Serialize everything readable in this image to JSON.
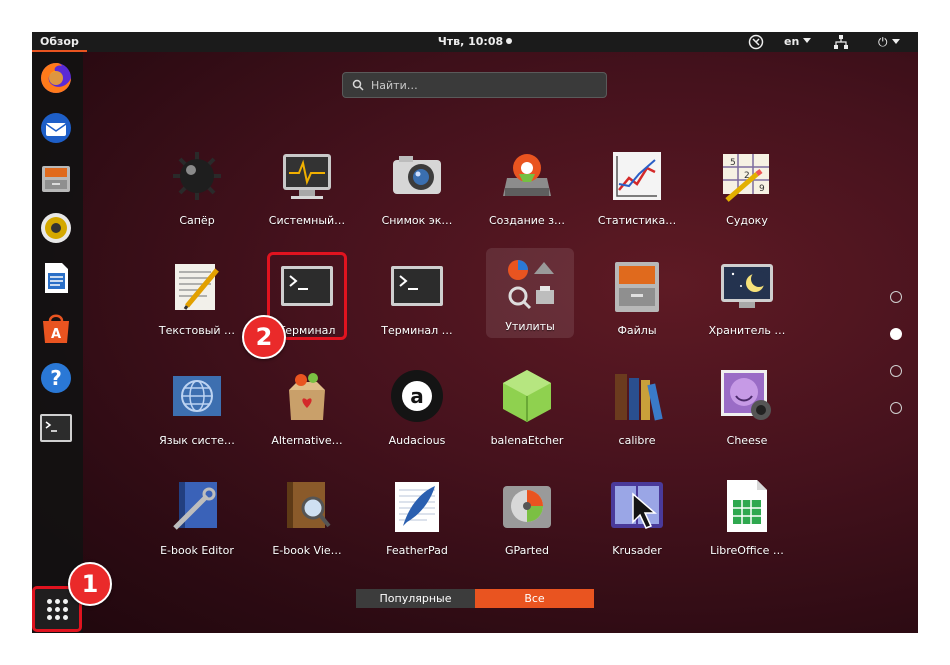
{
  "topbar": {
    "activities": "Обзор",
    "clock": "Чтв, 10:08",
    "language": "en"
  },
  "search": {
    "placeholder": "Найти…"
  },
  "apps": [
    {
      "label": "Сапёр",
      "icon": "mines-icon"
    },
    {
      "label": "Системный…",
      "icon": "system-monitor-icon"
    },
    {
      "label": "Снимок эк…",
      "icon": "screenshot-camera-icon"
    },
    {
      "label": "Создание з…",
      "icon": "startup-disk-creator-icon"
    },
    {
      "label": "Статистика…",
      "icon": "statistics-chart-icon"
    },
    {
      "label": "Судоку",
      "icon": "sudoku-icon"
    },
    {
      "label": "Текстовый …",
      "icon": "text-editor-icon"
    },
    {
      "label": "Терминал",
      "icon": "terminal-icon"
    },
    {
      "label": "Терминал …",
      "icon": "terminal-icon"
    },
    {
      "label": "Утилиты",
      "icon": "utilities-folder-icon"
    },
    {
      "label": "Файлы",
      "icon": "file-cabinet-icon"
    },
    {
      "label": "Хранитель …",
      "icon": "screensaver-icon"
    },
    {
      "label": "Язык систе…",
      "icon": "language-globe-icon"
    },
    {
      "label": "Alternative…",
      "icon": "alternative-box-icon"
    },
    {
      "label": "Audacious",
      "icon": "audacious-icon"
    },
    {
      "label": "balenaEtcher",
      "icon": "balena-etcher-icon"
    },
    {
      "label": "calibre",
      "icon": "calibre-books-icon"
    },
    {
      "label": "Cheese",
      "icon": "cheese-webcam-icon"
    },
    {
      "label": "E-book Editor",
      "icon": "ebook-editor-icon"
    },
    {
      "label": "E-book Vie…",
      "icon": "ebook-viewer-icon"
    },
    {
      "label": "FeatherPad",
      "icon": "featherpad-icon"
    },
    {
      "label": "GParted",
      "icon": "gparted-disk-icon"
    },
    {
      "label": "Krusader",
      "icon": "krusader-icon"
    },
    {
      "label": "LibreOffice …",
      "icon": "libreoffice-calc-icon"
    }
  ],
  "badges": {
    "one": "1",
    "two": "2"
  },
  "tabs": {
    "popular": "Популярные",
    "all": "Все"
  },
  "colors": {
    "accent": "#e95420",
    "highlight": "#e0131f"
  }
}
